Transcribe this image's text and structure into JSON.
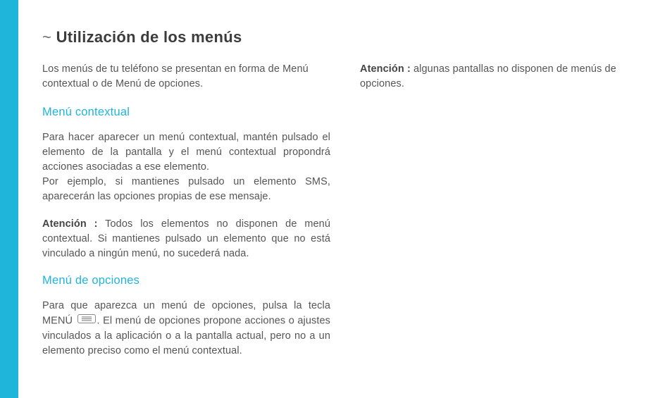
{
  "heading_prefix": "~ ",
  "heading_text": "Utilización de los menús",
  "intro": "Los menús de tu teléfono se presentan en forma de Menú contextual o de Menú de opciones.",
  "section1": {
    "title": "Menú contextual",
    "p1": "Para hacer aparecer un menú contextual, mantén pulsado el elemento de la pantalla y el menú contextual propondrá acciones asociadas a ese elemento.",
    "p1b": "Por ejemplo, si mantienes pulsado un elemento SMS, aparecerán las opciones propias de ese mensaje.",
    "attention_label": "Atención :",
    "attention_text": " Todos los elementos no disponen de menú contextual. Si mantienes pulsado un elemento que no está vinculado a ningún menú, no sucederá nada."
  },
  "section2": {
    "title": "Menú de opciones",
    "p1_part1": "Para que aparezca un menú de opciones, pulsa la tecla MENÚ ",
    "p1_part2": ". El menú de opciones propone acciones o ajustes vinculados a la aplicación o a la pantalla actual, pero no a un elemento preciso como el menú contextual.",
    "attention_label": "Atención :",
    "attention_text": " algunas pantallas no disponen de menús de opciones."
  }
}
